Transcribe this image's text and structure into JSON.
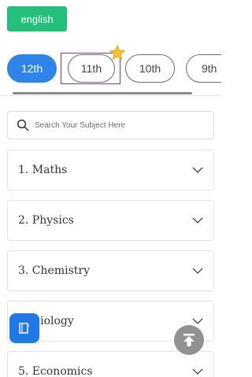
{
  "language_button": {
    "label": "english"
  },
  "grades": [
    {
      "label": "12th",
      "active": true
    },
    {
      "label": "11th",
      "active": false
    },
    {
      "label": "10th",
      "active": false
    },
    {
      "label": "9th",
      "active": false
    }
  ],
  "search": {
    "placeholder": "Search Your Subject Here"
  },
  "subjects": [
    {
      "label": "1. Maths"
    },
    {
      "label": "2. Physics"
    },
    {
      "label": "3. Chemistry"
    },
    {
      "label": "4. Biology"
    },
    {
      "label": "5. Economics"
    }
  ],
  "colors": {
    "language_button": "#22c07a",
    "active_grade": "#2f84ea",
    "fab_left": "#1f78e6",
    "fab_right": "#8c8c8c",
    "star": "#f2c230",
    "focus_outline": "#7b3a8c"
  },
  "icons": {
    "star": "star-icon",
    "search": "search-icon",
    "chevron": "chevron-down-icon",
    "fab_left": "book-icon",
    "fab_right": "scroll-to-top-icon"
  }
}
